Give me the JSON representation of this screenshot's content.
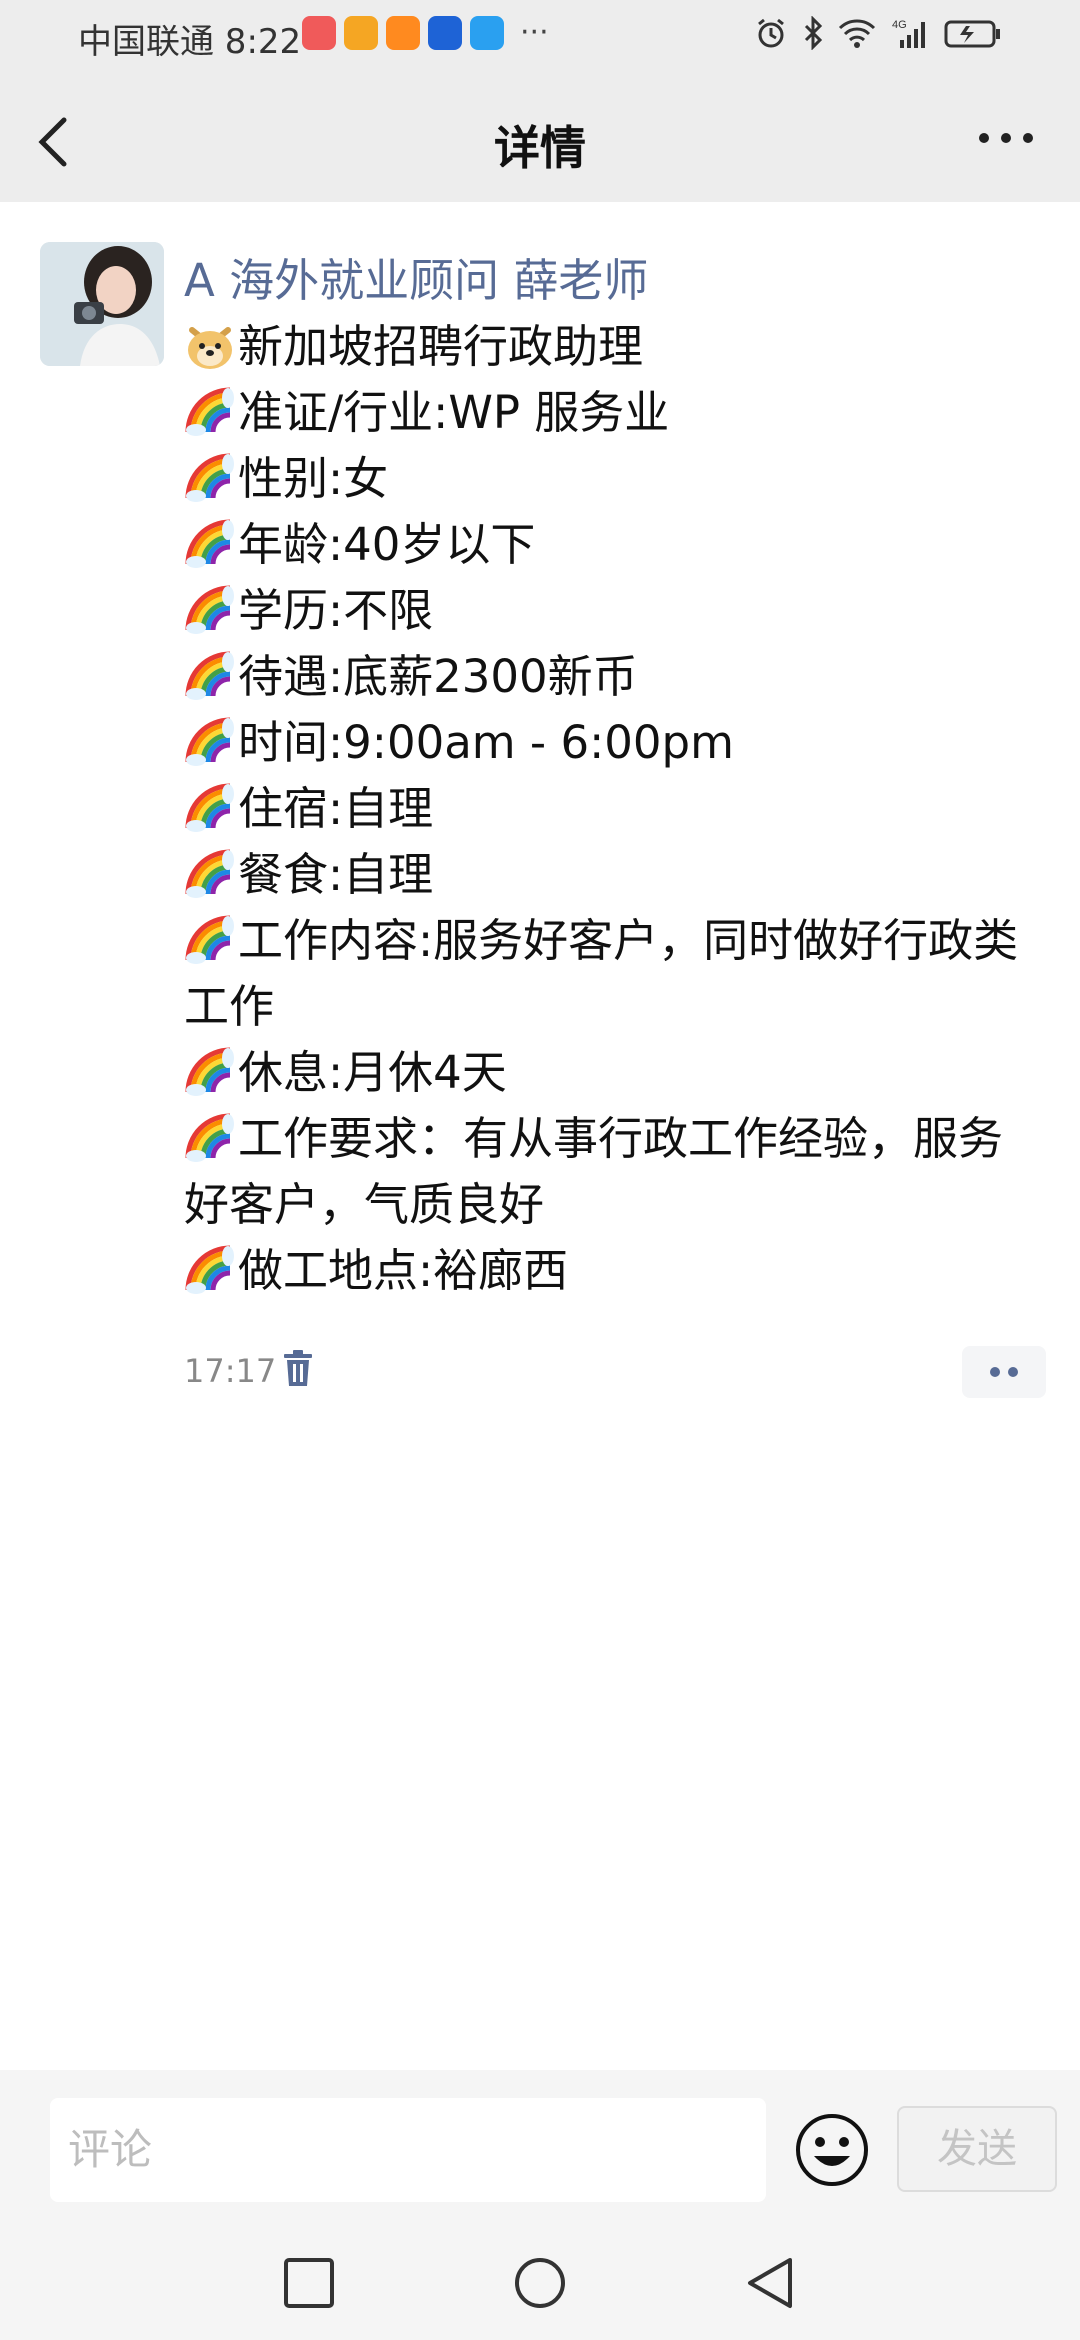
{
  "status_bar": {
    "carrier_time": "中国联通 8:22",
    "more": "···",
    "app_icon_colors": [
      "#f05a5a",
      "#f5a623",
      "#ff8a1f",
      "#1e63d6",
      "#2aa0f0"
    ],
    "icons": [
      "alarm-icon",
      "bluetooth-icon",
      "wifi-icon",
      "signal-4g-icon",
      "battery-icon"
    ],
    "network": "4G"
  },
  "header": {
    "title": "详情"
  },
  "post": {
    "author": "A 海外就业顾问 薛老师",
    "lines": [
      {
        "emoji": "doge",
        "text": "新加坡招聘行政助理"
      },
      {
        "emoji": "rainbow",
        "text": "准证/行业:WP 服务业"
      },
      {
        "emoji": "rainbow",
        "text": "性别:女"
      },
      {
        "emoji": "rainbow",
        "text": "年龄:40岁以下"
      },
      {
        "emoji": "rainbow",
        "text": "学历:不限"
      },
      {
        "emoji": "rainbow",
        "text": "待遇:底薪2300新币"
      },
      {
        "emoji": "rainbow",
        "text": "时间:9:00am - 6:00pm"
      },
      {
        "emoji": "rainbow",
        "text": "住宿:自理"
      },
      {
        "emoji": "rainbow",
        "text": "餐食:自理"
      },
      {
        "emoji": "rainbow",
        "text": "工作内容:服务好客户，同时做好行政类工作"
      },
      {
        "emoji": "rainbow",
        "text": "休息:月休4天"
      },
      {
        "emoji": "rainbow",
        "text": "工作要求：有从事行政工作经验，服务好客户，气质良好"
      },
      {
        "emoji": "rainbow",
        "text": "做工地点:裕廊西"
      }
    ],
    "time": "17:17"
  },
  "comment": {
    "placeholder": "评论",
    "send_label": "发送"
  },
  "colors": {
    "author": "#576b95",
    "bar_bg": "#ededed"
  }
}
